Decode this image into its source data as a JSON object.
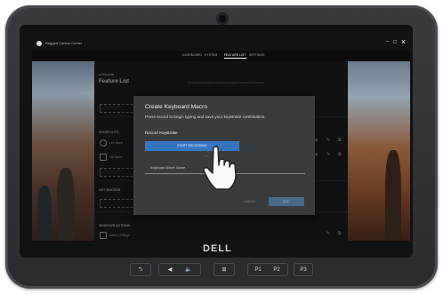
{
  "window": {
    "app_title": "Rugged Control Center",
    "controls": {
      "minimize": "–",
      "maximize": "☐",
      "close": "✕"
    }
  },
  "nav": {
    "tabs": [
      {
        "label": "DASHBOARD",
        "active": false
      },
      {
        "label": "SYSTEM",
        "active": false
      },
      {
        "label": "FEATURE LIST",
        "active": true
      },
      {
        "label": "SETTINGS",
        "active": false
      }
    ]
  },
  "panel": {
    "app_name": "AT FALCON",
    "title": "Feature List",
    "hint": "Try out the various features and set up a keyboard shortcut for the features.",
    "sections": {
      "shortcuts": "SHORTCUTS",
      "key_macros": "KEY MACROS",
      "windows_actions": "WINDOWS ACTIONS"
    },
    "rows": [
      {
        "label": "Link Name",
        "icon": "link-icon"
      },
      {
        "label": "File Name",
        "icon": "file-icon"
      },
      {
        "label": "Battery Settings",
        "icon": "battery-icon"
      }
    ]
  },
  "dialog": {
    "title": "Create Keyboard Macro",
    "subtitle": "Press record to begin typing and save your keystroke combination.",
    "record_label": "Record Keystroke",
    "start_button": "START RECORDING",
    "name_placeholder": "Keyboard Macro Name",
    "cancel_button": "CANCEL",
    "add_button": "ADD"
  },
  "device": {
    "brand": "DELL",
    "hw_buttons": {
      "back": "⮌",
      "vol_down": "◀",
      "vol_up": "🔈",
      "windows": "⊞",
      "p1": "P1",
      "p2": "P2",
      "p3": "P3"
    }
  },
  "colors": {
    "accent": "#3576c0",
    "add_disabled": "#4a6a88"
  }
}
